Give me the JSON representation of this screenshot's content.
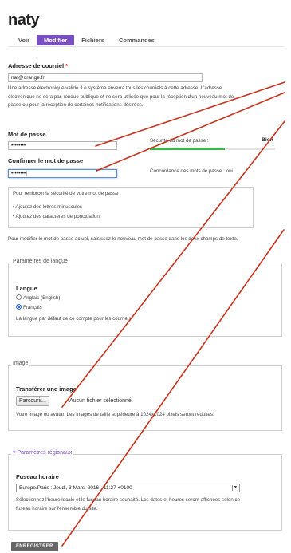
{
  "page": {
    "title": "naty",
    "tabs": [
      {
        "label": "Voir"
      },
      {
        "label": "Modifier",
        "active": true
      },
      {
        "label": "Fichiers"
      },
      {
        "label": "Commandes"
      }
    ]
  },
  "email": {
    "label": "Adresse de courriel",
    "required_mark": "*",
    "value": "nat@orange.fr",
    "description_line1": "Une adresse électronique valide. Le système enverra tous les courriels à cette adresse. L'adresse",
    "description_line2": "électronique ne sera pas rendue publique et ne sera utilisée que pour la réception d'un nouveau mot de",
    "description_line3": "passe ou pour la réception de certaines notifications désirées."
  },
  "password": {
    "label": "Mot de passe",
    "value": "••••••••",
    "strength_label": "Sécurité du mot de passe :",
    "strength_value": "Bien",
    "strength_fraction": 0.6,
    "strength_color": "#3bb54a",
    "confirm_label": "Confirmer le mot de passe",
    "confirm_value": "••••••••|",
    "match_label": "Concordance des mots de passe :",
    "match_value": "oui",
    "tips_title": "Pour renforcer la sécurité de votre mot de passe :",
    "tips": [
      "Ajoutez des lettres minuscules",
      "Ajoutez des caractères de ponctuation"
    ],
    "help": "Pour modifier le mot de passe actuel, saisissez le nouveau mot de passe dans les deux champs de texte."
  },
  "language": {
    "legend": "Paramètres de langue",
    "label": "Langue",
    "options": [
      {
        "label": "Anglais (English)",
        "selected": false
      },
      {
        "label": "Français",
        "selected": true
      }
    ],
    "description": "La langue par défaut de ce compte pour les courriels."
  },
  "image": {
    "legend": "Image",
    "label": "Transférer une image",
    "button": "Parcourir...",
    "status": "Aucun fichier sélectionné.",
    "description": "Votre image ou avatar. Les images de taille supérieure à 1024x1024 pixels seront réduites."
  },
  "regional": {
    "legend": "Paramètres régionaux",
    "toggle_icon": "▾",
    "label": "Fuseau horaire",
    "selected": "Europe/Paris : Jeudi, 3 Mars, 2016 - 11:27 +0100",
    "description_line1": "Sélectionnez l'heure locale et le fuseau horaire souhaité. Les dates et heures seront affichées selon ce",
    "description_line2": "fuseau horaire sur l'ensemble du site."
  },
  "actions": {
    "save": "ENREGISTRER"
  },
  "annotations": {
    "color": "#c8321c"
  }
}
